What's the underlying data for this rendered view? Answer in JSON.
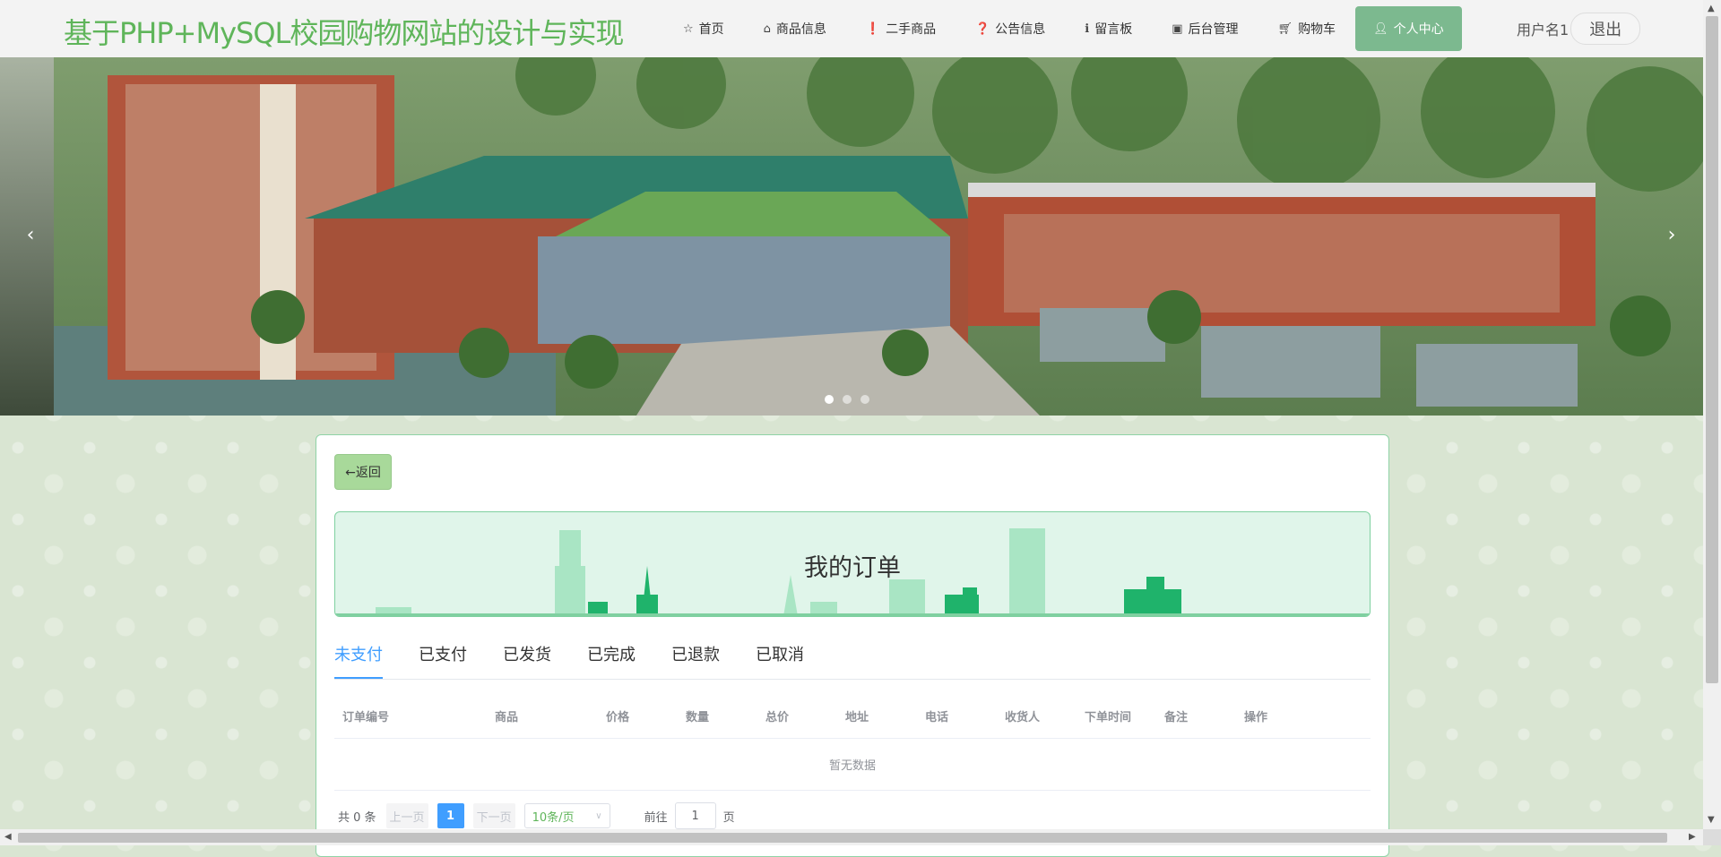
{
  "header": {
    "site_title": "基于PHP+MySQL校园购物网站的设计与实现",
    "nav": [
      {
        "label": "首页",
        "icon": "star-icon"
      },
      {
        "label": "商品信息",
        "icon": "bag-icon"
      },
      {
        "label": "二手商品",
        "icon": "alert-icon"
      },
      {
        "label": "公告信息",
        "icon": "question-icon"
      },
      {
        "label": "留言板",
        "icon": "info-icon"
      },
      {
        "label": "后台管理",
        "icon": "building-icon"
      },
      {
        "label": "购物车",
        "icon": "cart-icon"
      },
      {
        "label": "个人中心",
        "icon": "user-icon",
        "active": true
      }
    ],
    "username": "用户名1",
    "logout_label": "退出"
  },
  "banner": {
    "prev_glyph": "‹",
    "next_glyph": "›",
    "slide_count": 3,
    "active_slide": 1
  },
  "panel": {
    "back_label": "←返回",
    "title": "我的订单",
    "tabs": [
      "未支付",
      "已支付",
      "已发货",
      "已完成",
      "已退款",
      "已取消"
    ],
    "active_tab": 0,
    "columns": [
      "订单编号",
      "商品",
      "价格",
      "数量",
      "总价",
      "地址",
      "电话",
      "收货人",
      "下单时间",
      "备注",
      "操作"
    ],
    "empty_text": "暂无数据",
    "pagination": {
      "total_text": "共 0 条",
      "prev_label": "上一页",
      "current_page": "1",
      "next_label": "下一页",
      "page_size": "10条/页",
      "goto_prefix": "前往",
      "goto_value": "1",
      "goto_suffix": "页"
    }
  },
  "colors": {
    "accent": "#5fb55a",
    "active_nav": "#7cb98f",
    "primary_blue": "#409eff"
  }
}
